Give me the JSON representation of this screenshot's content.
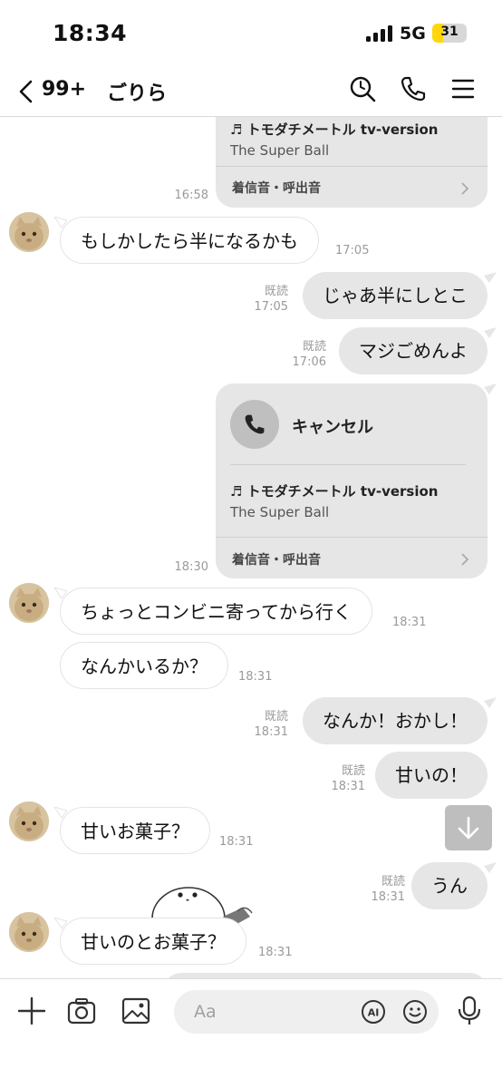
{
  "status_bar": {
    "time": "18:34",
    "network": "5G",
    "battery": "31",
    "battery_level": 0.31
  },
  "header": {
    "back_count": "99+",
    "title": "ごりら"
  },
  "messages": {
    "card1": {
      "song": "♬ トモダチメートル tv-version",
      "artist": "The Super Ball",
      "footer": "着信音・呼出音",
      "time": "16:58"
    },
    "m1": {
      "text": "もしかしたら半になるかも",
      "time": "17:05"
    },
    "m2": {
      "text": "じゃあ半にしとこ",
      "read": "既読",
      "time": "17:05"
    },
    "m3": {
      "text": "マジごめんよ",
      "read": "既読",
      "time": "17:06"
    },
    "card2": {
      "call_label": "キャンセル",
      "song": "♬ トモダチメートル tv-version",
      "artist": "The Super Ball",
      "footer": "着信音・呼出音",
      "time": "18:30"
    },
    "m4": {
      "text": "ちょっとコンビニ寄ってから行く",
      "time": "18:31"
    },
    "m5": {
      "text": "なんかいるか？",
      "time": "18:31"
    },
    "m6": {
      "text": "なんか！おかし！",
      "read": "既読",
      "time": "18:31"
    },
    "m7": {
      "text": "甘いの！",
      "read": "既読",
      "time": "18:31"
    },
    "m8": {
      "text": "甘いお菓子？",
      "time": "18:31"
    },
    "m9": {
      "text": "うん",
      "read": "既読",
      "time": "18:31"
    },
    "m10": {
      "text": "甘いのとお菓子？",
      "time": "18:31"
    }
  },
  "input": {
    "placeholder": "Aa",
    "ai_label": "AI"
  },
  "colors": {
    "bubble_out": "#e6e6e6",
    "bubble_in": "#ffffff",
    "meta": "#9a9a9a",
    "battery": "#ffd60a"
  },
  "icons": [
    "back-chevron-icon",
    "search-icon",
    "phone-icon",
    "menu-icon",
    "plus-icon",
    "camera-icon",
    "image-icon",
    "ai-icon",
    "emoji-icon",
    "microphone-icon",
    "arrow-down-icon",
    "music-note-icon",
    "chevron-right-icon"
  ]
}
